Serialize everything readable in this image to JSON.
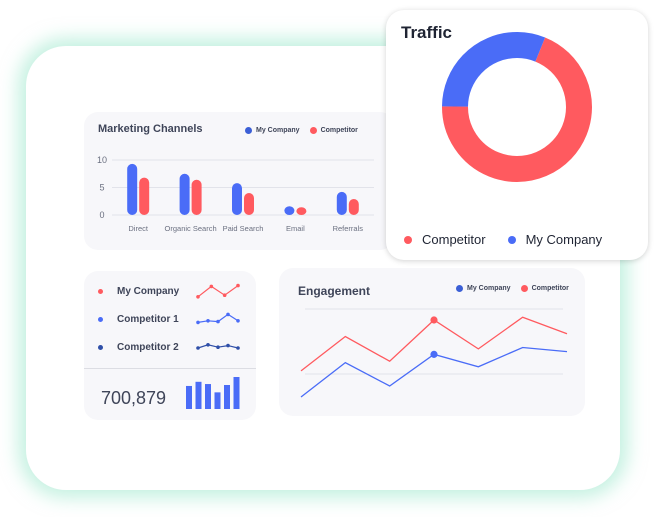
{
  "colors": {
    "my_company": "#4a6cf7",
    "competitor": "#ff5a5f",
    "competitor2": "#2f4fa8",
    "grid": "#e2e3ea",
    "axis_text": "#6b7080"
  },
  "marketing": {
    "title": "Marketing  Channels",
    "legend": {
      "my_company": "My Company",
      "competitor": "Competitor"
    }
  },
  "traffic": {
    "title": "Traffic",
    "legend": {
      "competitor": "Competitor",
      "my_company": "My Company"
    }
  },
  "competitors": {
    "rows": [
      {
        "label": "My Company",
        "color": "#ff5a5f",
        "spark": [
          0.2,
          0.85,
          0.3,
          0.9
        ]
      },
      {
        "label": "Competitor 1",
        "color": "#4a6cf7",
        "spark": [
          0.35,
          0.45,
          0.4,
          0.85,
          0.45
        ]
      },
      {
        "label": "Competitor 2",
        "color": "#2f4fa8",
        "spark": [
          0.5,
          0.7,
          0.55,
          0.65,
          0.5
        ]
      }
    ],
    "total": "700,879",
    "mini_bars": [
      0.72,
      0.85,
      0.78,
      0.52,
      0.75,
      1.0
    ]
  },
  "engagement": {
    "title": "Engagement",
    "legend": {
      "my_company": "My Company",
      "competitor": "Competitor"
    }
  },
  "chart_data": [
    {
      "type": "bar",
      "title": "Marketing  Channels",
      "categories": [
        "Direct",
        "Organic  Search",
        "Paid Search",
        "Email",
        "Referrals"
      ],
      "series": [
        {
          "name": "My Company",
          "values": [
            9.3,
            7.5,
            5.8,
            1.6,
            4.2
          ]
        },
        {
          "name": "Competitor",
          "values": [
            6.8,
            6.4,
            4.0,
            1.4,
            2.9
          ]
        }
      ],
      "yticks": [
        "10",
        "5",
        "0"
      ],
      "ylim": [
        0,
        10
      ],
      "grid": true,
      "legend_position": "top-right"
    },
    {
      "type": "pie",
      "title": "Traffic",
      "donut": true,
      "slices": [
        {
          "name": "Competitor",
          "value": 69
        },
        {
          "name": "My Company",
          "value": 31
        }
      ],
      "legend_position": "bottom"
    },
    {
      "type": "line",
      "title": "Engagement",
      "x": [
        0,
        1,
        2,
        3,
        4,
        5,
        6
      ],
      "series": [
        {
          "name": "Competitor",
          "values": [
            57,
            82,
            64,
            94,
            73,
            96,
            84
          ],
          "highlight_index": 3
        },
        {
          "name": "My Company",
          "values": [
            38,
            63,
            46,
            69,
            60,
            74,
            71
          ],
          "highlight_index": 3
        }
      ],
      "ylim": [
        30,
        110
      ],
      "grid": true,
      "legend_position": "top-right"
    }
  ]
}
